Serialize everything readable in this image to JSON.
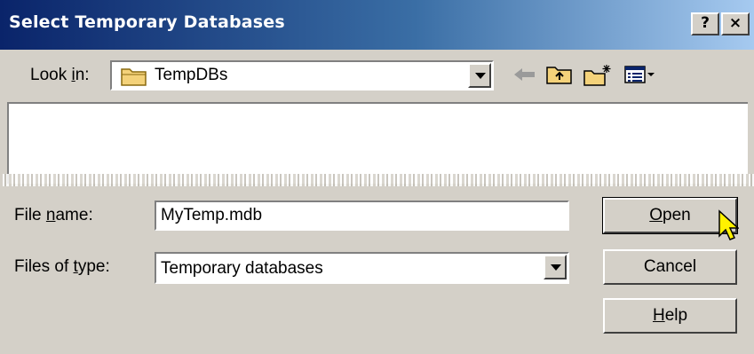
{
  "window": {
    "title": "Select Temporary Databases",
    "help_label": "?",
    "close_label": "×"
  },
  "lookin": {
    "label_pre": "Look ",
    "label_accel": "i",
    "label_post": "n:",
    "value": "TempDBs",
    "icon": "folder-icon"
  },
  "toolbar": {
    "icons": [
      "back-arrow-icon",
      "up-folder-icon",
      "new-folder-icon",
      "view-menu-icon"
    ]
  },
  "filename": {
    "label_pre": "File ",
    "label_accel": "n",
    "label_post": "ame:",
    "value": "MyTemp.mdb"
  },
  "filetype": {
    "label_pre": "Files of ",
    "label_accel": "t",
    "label_post": "ype:",
    "value": "Temporary databases"
  },
  "buttons": {
    "open_accel": "O",
    "open_rest": "pen",
    "cancel": "Cancel",
    "help_accel": "H",
    "help_rest": "elp"
  }
}
